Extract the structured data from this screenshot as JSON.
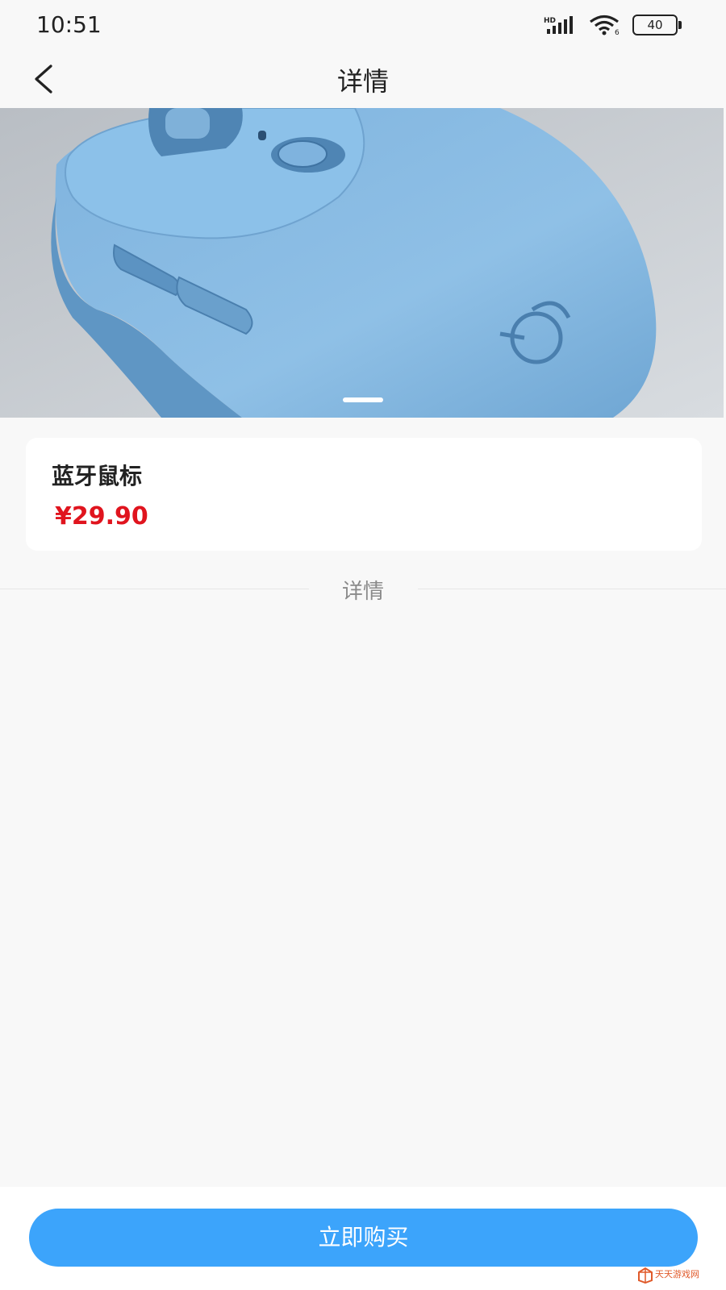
{
  "status_bar": {
    "time": "10:51",
    "battery": "40",
    "network_badge": "HD"
  },
  "nav": {
    "title": "详情"
  },
  "banner": {
    "slide_index": 1,
    "slide_count": 1
  },
  "product": {
    "name": "蓝牙鼠标",
    "price": "¥29.90",
    "price_color": "#e0141e"
  },
  "details": {
    "section_label": "详情"
  },
  "actions": {
    "buy_label": "立即购买",
    "accent_color": "#3ca4fb"
  },
  "watermark": {
    "text": "天天游戏网"
  }
}
